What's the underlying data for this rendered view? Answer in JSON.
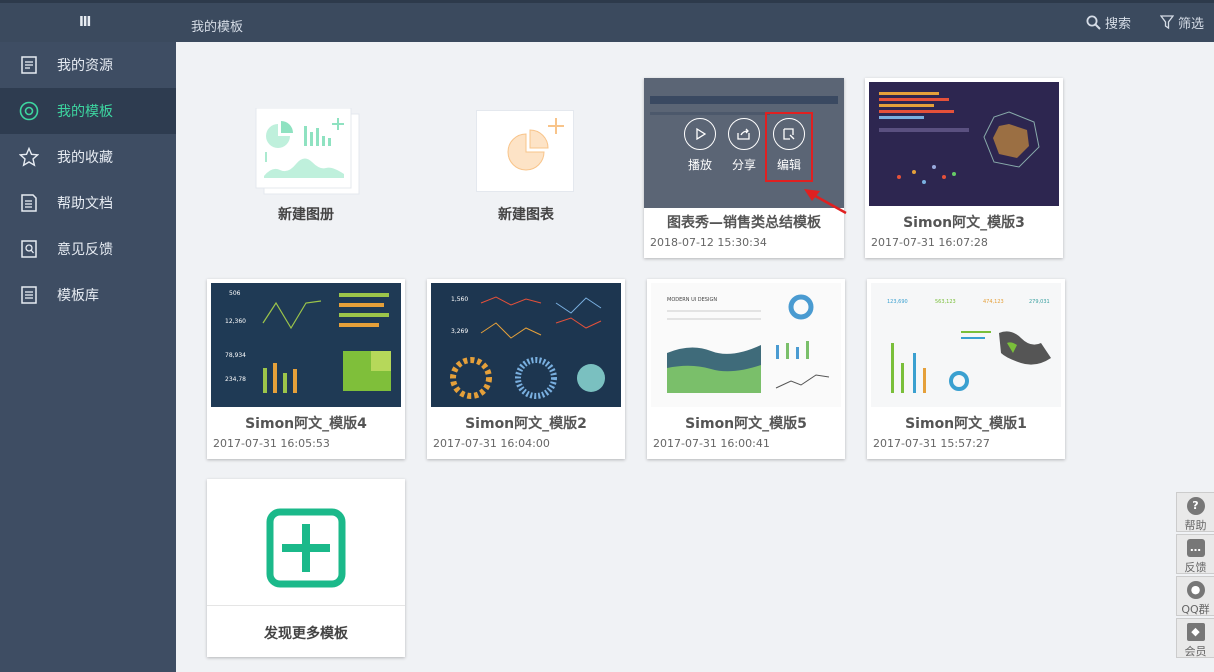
{
  "header": {
    "menu_icon": "Ⅲ",
    "breadcrumb": "我的模板",
    "search_label": "搜索",
    "filter_label": "筛选"
  },
  "sidebar": {
    "items": [
      {
        "label": "我的资源",
        "icon": "document-icon"
      },
      {
        "label": "我的模板",
        "icon": "target-icon",
        "active": true
      },
      {
        "label": "我的收藏",
        "icon": "star-icon"
      },
      {
        "label": "帮助文档",
        "icon": "doc-icon"
      },
      {
        "label": "意见反馈",
        "icon": "feedback-icon"
      },
      {
        "label": "模板库",
        "icon": "library-icon"
      }
    ]
  },
  "new_album": {
    "label": "新建图册"
  },
  "new_chart": {
    "label": "新建图表"
  },
  "templates": [
    {
      "name": "图表秀—销售类总结模板",
      "date": "2018-07-12 15:30:34",
      "overlay": {
        "play": "播放",
        "share": "分享",
        "edit": "编辑"
      }
    },
    {
      "name": "Simon阿文_模版3",
      "date": "2017-07-31 16:07:28"
    },
    {
      "name": "Simon阿文_模版4",
      "date": "2017-07-31 16:05:53"
    },
    {
      "name": "Simon阿文_模版2",
      "date": "2017-07-31 16:04:00"
    },
    {
      "name": "Simon阿文_模版5",
      "date": "2017-07-31 16:00:41"
    },
    {
      "name": "Simon阿文_模版1",
      "date": "2017-07-31 15:57:27"
    }
  ],
  "discover": {
    "label": "发现更多模板"
  },
  "right_panel": [
    {
      "label": "帮助",
      "icon": "question-icon"
    },
    {
      "label": "反馈",
      "icon": "chat-icon"
    },
    {
      "label": "QQ群",
      "icon": "users-icon"
    },
    {
      "label": "会员",
      "icon": "diamond-icon"
    }
  ],
  "thumb_texts": {
    "t4": [
      "506",
      "12,360",
      "78,934",
      "234,78"
    ],
    "t2": [
      "1,560",
      "3,269"
    ],
    "t5": [
      "MODERN UI DESIGN"
    ],
    "t1": [
      "123,690",
      "563,123",
      "474,123",
      "279,031"
    ]
  },
  "colors": {
    "accent": "#3dd6a0",
    "sidebar": "#3e4d63",
    "topbar": "#3b4a5e",
    "highlight": "#e02020"
  }
}
